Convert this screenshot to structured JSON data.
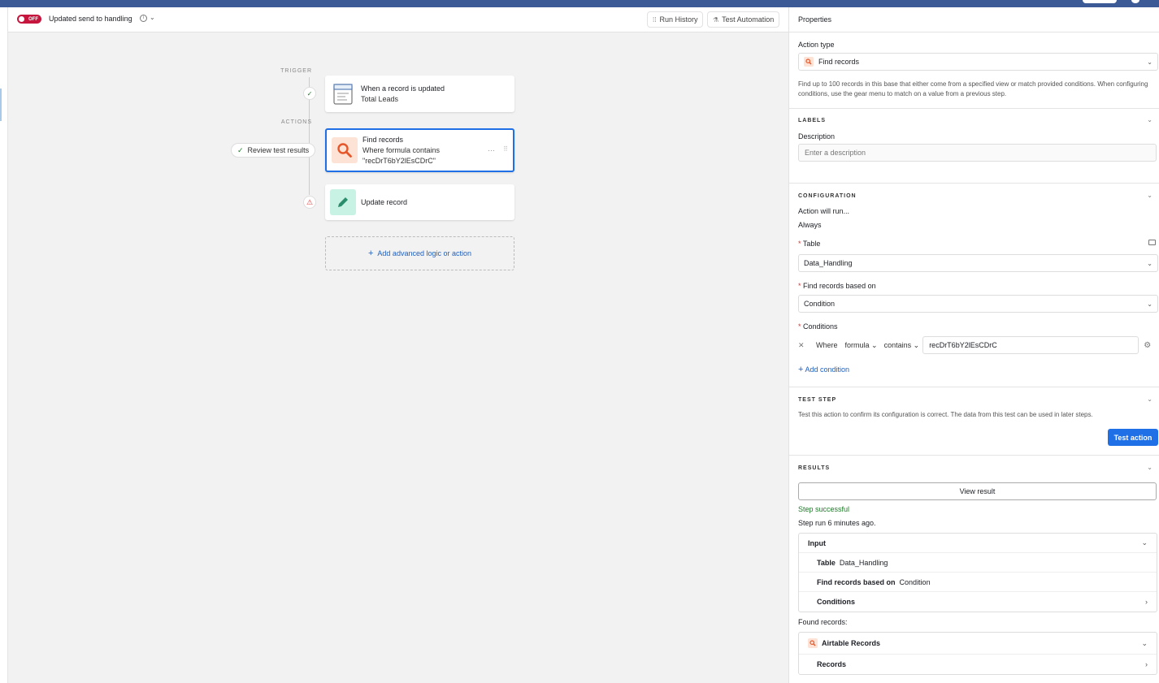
{
  "header": {
    "toggle_label": "OFF",
    "automation_name": "Updated send to handling",
    "run_history": "Run History",
    "test_automation": "Test Automation"
  },
  "canvas": {
    "trigger_label": "TRIGGER",
    "actions_label": "ACTIONS",
    "trigger_card": {
      "title": "When a record is updated",
      "subtitle": "Total Leads"
    },
    "find_card": {
      "title": "Find records",
      "subtitle_line1": "Where formula contains",
      "subtitle_line2": "\"recDrT6bY2lEsCDrC\""
    },
    "update_card": {
      "title": "Update record"
    },
    "review_test_results": "Review test results",
    "add_logic": "Add advanced logic or action"
  },
  "panel": {
    "title": "Properties",
    "action_type_label": "Action type",
    "action_type_value": "Find records",
    "action_description": "Find up to 100 records in this base that either come from a specified view or match provided conditions. When configuring conditions, use the gear menu to match on a value from a previous step.",
    "labels_heading": "LABELS",
    "description_label": "Description",
    "description_placeholder": "Enter a description",
    "configuration_heading": "CONFIGURATION",
    "action_will_run_label": "Action will run...",
    "action_will_run_value": "Always",
    "table_label": "Table",
    "table_value": "Data_Handling",
    "find_based_label": "Find records based on",
    "find_based_value": "Condition",
    "conditions_label": "Conditions",
    "condition": {
      "where": "Where",
      "field": "formula",
      "operator": "contains",
      "value": "recDrT6bY2lEsCDrC"
    },
    "add_condition": "Add condition",
    "test_step_heading": "TEST STEP",
    "test_step_desc": "Test this action to confirm its configuration is correct. The data from this test can be used in later steps.",
    "test_action": "Test action",
    "results_heading": "RESULTS",
    "view_result": "View result",
    "step_successful": "Step successful",
    "step_run": "Step run 6 minutes ago.",
    "input": {
      "heading": "Input",
      "table_key": "Table",
      "table_val": "Data_Handling",
      "find_key": "Find records based on",
      "find_val": "Condition",
      "conditions": "Conditions"
    },
    "found_records_label": "Found records:",
    "found": {
      "airtable_records": "Airtable Records",
      "records": "Records"
    }
  }
}
